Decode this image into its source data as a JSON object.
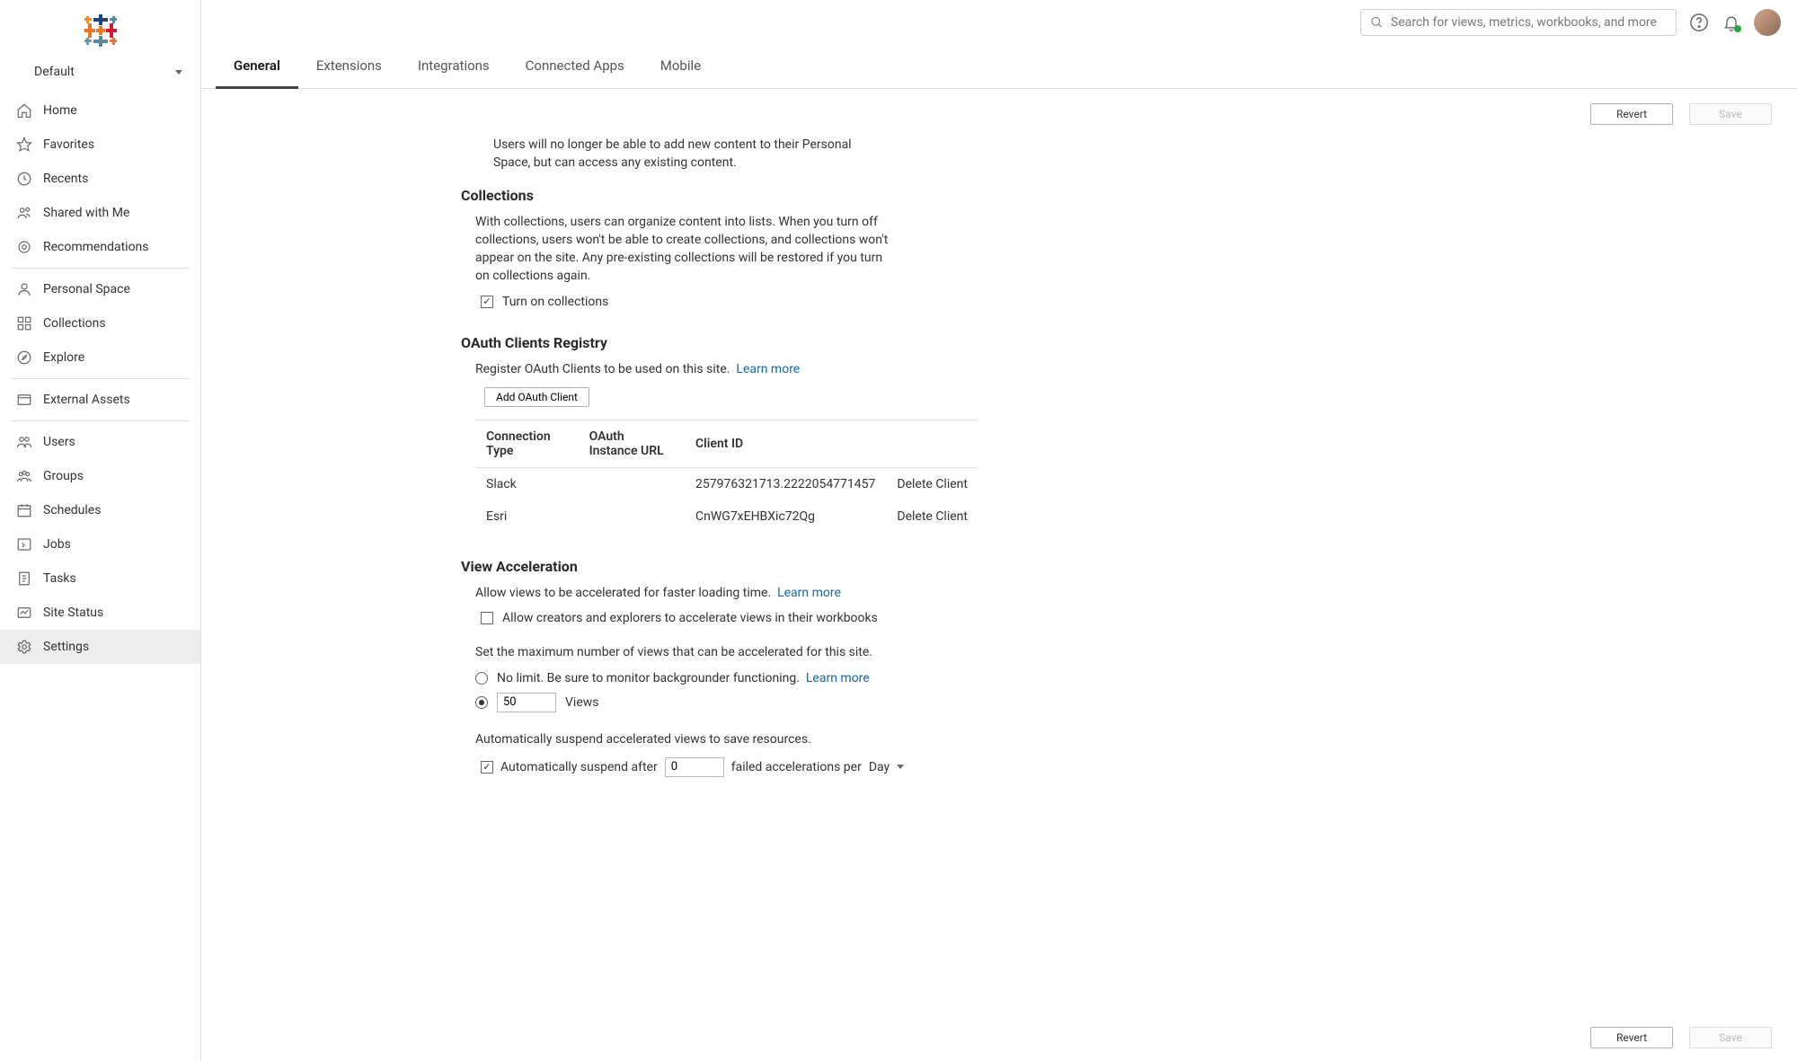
{
  "site": "Default",
  "sidebar": {
    "items": [
      {
        "label": "Home"
      },
      {
        "label": "Favorites"
      },
      {
        "label": "Recents"
      },
      {
        "label": "Shared with Me"
      },
      {
        "label": "Recommendations"
      },
      {
        "label": "Personal Space"
      },
      {
        "label": "Collections"
      },
      {
        "label": "Explore"
      },
      {
        "label": "External Assets"
      },
      {
        "label": "Users"
      },
      {
        "label": "Groups"
      },
      {
        "label": "Schedules"
      },
      {
        "label": "Jobs"
      },
      {
        "label": "Tasks"
      },
      {
        "label": "Site Status"
      },
      {
        "label": "Settings"
      }
    ]
  },
  "search": {
    "placeholder": "Search for views, metrics, workbooks, and more"
  },
  "tabs": {
    "general": "General",
    "extensions": "Extensions",
    "integrations": "Integrations",
    "connected_apps": "Connected Apps",
    "mobile": "Mobile"
  },
  "actions": {
    "revert": "Revert",
    "save": "Save"
  },
  "personal_space": {
    "helper": "Users will no longer be able to add new content to their Personal Space, but can access any existing content."
  },
  "collections": {
    "title": "Collections",
    "desc": "With collections, users can organize content into lists. When you turn off collections, users won't be able to create collections, and collections won't appear on the site. Any pre-existing collections will be restored if you turn on collections again.",
    "checkbox_label": "Turn on collections"
  },
  "oauth": {
    "title": "OAuth Clients Registry",
    "desc": "Register OAuth Clients to be used on this site.",
    "learn_more": "Learn more",
    "add_btn": "Add OAuth Client",
    "headers": {
      "type": "Connection Type",
      "url": "OAuth Instance URL",
      "client": "Client ID"
    },
    "rows": [
      {
        "type": "Slack",
        "url": "",
        "client": "257976321713.2222054771457",
        "action": "Delete Client"
      },
      {
        "type": "Esri",
        "url": "",
        "client": "CnWG7xEHBXic72Qg",
        "action": "Delete Client"
      }
    ]
  },
  "view_accel": {
    "title": "View Acceleration",
    "desc": "Allow views to be accelerated for faster loading time.",
    "learn_more": "Learn more",
    "checkbox_label": "Allow creators and explorers to accelerate views in their workbooks",
    "set_max": "Set the maximum number of views that can be accelerated for this site.",
    "no_limit": "No limit. Be sure to monitor backgrounder functioning.",
    "views_value": "50",
    "views_label": "Views",
    "auto_suspend_desc": "Automatically suspend accelerated views to save resources.",
    "auto_suspend_label": "Automatically suspend after",
    "auto_suspend_value": "0",
    "failed_text": "failed accelerations per",
    "period": "Day"
  }
}
